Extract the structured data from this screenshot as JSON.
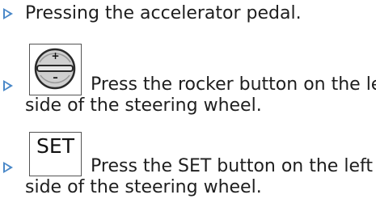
{
  "items": [
    {
      "text": "Pressing the accelerator pedal."
    },
    {
      "icon": "rocker-button-icon",
      "icon_plus": "+",
      "icon_minus": "–",
      "line1": "Press the rocker button on the left",
      "line2": "side of the steering wheel."
    },
    {
      "icon": "set-button-icon",
      "icon_label": "SET",
      "line1": "Press the SET button on the left",
      "line2": "side of the steering wheel."
    }
  ],
  "colors": {
    "bullet": "#4a88c8",
    "text": "#1e1e1e",
    "icon_border": "#555555"
  }
}
